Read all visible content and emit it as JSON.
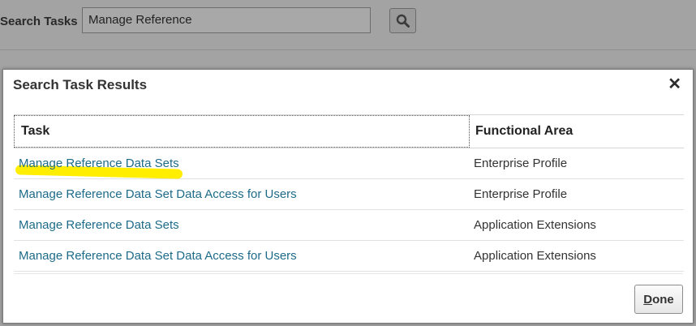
{
  "background": {
    "search_label": "Search Tasks",
    "search_value": "Manage Reference",
    "search_icon": "search-icon"
  },
  "dialog": {
    "title": "Search Task Results",
    "close_label": "✕",
    "columns": {
      "task": "Task",
      "area": "Functional Area"
    },
    "rows": [
      {
        "task": "Manage Reference Data Sets",
        "area": "Enterprise Profile"
      },
      {
        "task": "Manage Reference Data Set Data Access for Users",
        "area": "Enterprise Profile"
      },
      {
        "task": "Manage Reference Data Sets",
        "area": "Application Extensions"
      },
      {
        "task": "Manage Reference Data Set Data Access for Users",
        "area": "Application Extensions"
      }
    ],
    "done_label_first": "D",
    "done_label_rest": "one"
  },
  "colors": {
    "link": "#1d6b89",
    "highlight": "#ffee00"
  }
}
